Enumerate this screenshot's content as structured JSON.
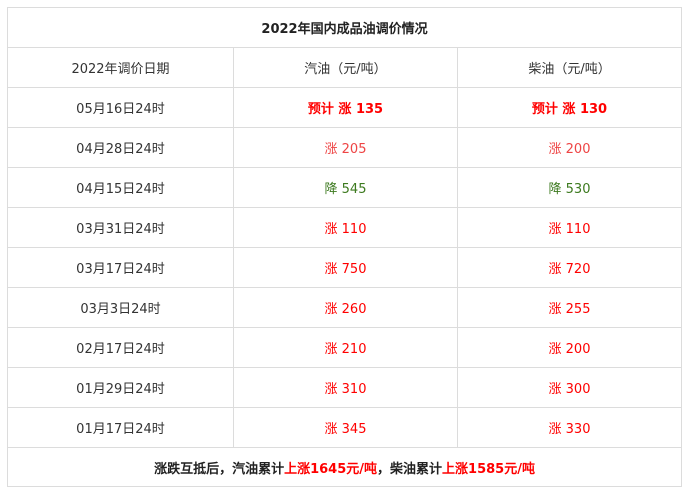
{
  "title": "2022年国内成品油调价情况",
  "headers": [
    "2022年调价日期",
    "汽油（元/吨）",
    "柴油（元/吨）"
  ],
  "rows": [
    {
      "date": "05月16日24时",
      "gasoline": "预计 涨 135",
      "diesel": "预计 涨 130",
      "bold": true
    },
    {
      "date": "04月28日24时",
      "gasoline": "涨 205",
      "diesel": "涨 200"
    },
    {
      "date": "04月15日24时",
      "gasoline": "降 545",
      "diesel": "降 530"
    },
    {
      "date": "03月31日24时",
      "gasoline": "涨 110",
      "diesel": "涨 110"
    },
    {
      "date": "03月17日24时",
      "gasoline": "涨 750",
      "diesel": "涨 720"
    },
    {
      "date": "03月3日24时",
      "gasoline": "涨 260",
      "diesel": "涨 255"
    },
    {
      "date": "02月17日24时",
      "gasoline": "涨 210",
      "diesel": "涨 200"
    },
    {
      "date": "01月29日24时",
      "gasoline": "涨 310",
      "diesel": "涨 300"
    },
    {
      "date": "01月17日24时",
      "gasoline": "涨 345",
      "diesel": "涨 330"
    }
  ],
  "footer": {
    "prefix": "涨跌互抵后，汽油累计",
    "gasoline_total": "上涨1645元/吨",
    "middle": "，柴油累计",
    "diesel_total": "上涨1585元/吨"
  },
  "colors": {
    "rise": "#ff0000",
    "rise_light": "#ee4444",
    "fall": "#3d7a1f",
    "border": "#dcdcdc"
  }
}
